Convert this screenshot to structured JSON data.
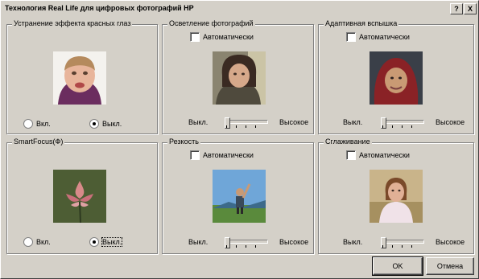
{
  "window": {
    "title": "Технология Real Life для цифровых фотографий HP",
    "help_glyph": "?",
    "close_glyph": "X"
  },
  "panels": {
    "redeye": {
      "title": "Устранение эффекта красных глаз",
      "on_label": "Вкл.",
      "off_label": "Выкл.",
      "selected": "off"
    },
    "lighting": {
      "title": "Осветление фотографий",
      "auto_label": "Автоматически",
      "low_label": "Выкл.",
      "high_label": "Высокое",
      "auto_checked": false,
      "level": 0
    },
    "flash": {
      "title": "Адаптивная вспышка",
      "auto_label": "Автоматически",
      "low_label": "Выкл.",
      "high_label": "Высокое",
      "auto_checked": false,
      "level": 0
    },
    "smartfocus": {
      "title": "SmartFocus(Ф)",
      "on_label": "Вкл.",
      "off_label": "Выкл.",
      "selected": "off"
    },
    "sharpness": {
      "title": "Резкость",
      "auto_label": "Автоматически",
      "low_label": "Выкл.",
      "high_label": "Высокое",
      "auto_checked": false,
      "level": 0
    },
    "smoothing": {
      "title": "Сглаживание",
      "auto_label": "Автоматически",
      "low_label": "Выкл.",
      "high_label": "Высокое",
      "auto_checked": false,
      "level": 0
    }
  },
  "buttons": {
    "ok": "OK",
    "cancel": "Отмена"
  }
}
